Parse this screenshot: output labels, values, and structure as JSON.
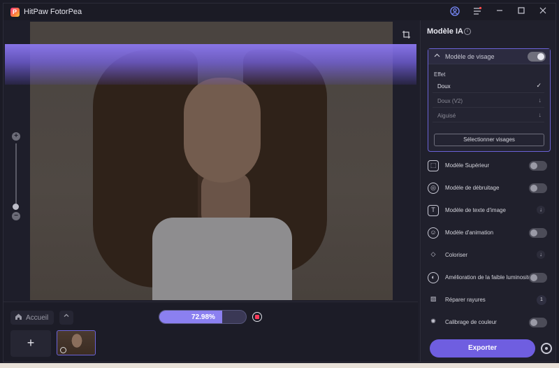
{
  "titlebar": {
    "app_name": "HitPaw FotorPea",
    "logo_letter": "P",
    "icons": [
      "user-icon",
      "menu-icon",
      "minimize-icon",
      "maximize-icon",
      "close-icon"
    ]
  },
  "canvas": {
    "icons": [
      "crop-icon",
      "zoom-in-icon",
      "zoom-out-icon"
    ]
  },
  "bottom": {
    "home_label": "Accueil",
    "progress_text": "72.98%",
    "progress_value": 0.7298,
    "add_symbol": "+"
  },
  "panel": {
    "title": "Modèle IA",
    "face_model": {
      "label": "Modèle de visage",
      "enabled": true,
      "effect_label": "Effet",
      "options": [
        {
          "label": "Doux",
          "state": "selected",
          "icon": "check-icon"
        },
        {
          "label": "Doux (V2)",
          "state": "download",
          "icon": "download-icon"
        },
        {
          "label": "Aiguisé",
          "state": "download",
          "icon": "download-icon"
        }
      ],
      "select_faces_label": "Sélectionner visages"
    },
    "models": [
      {
        "label": "Modèle Supérieur",
        "control": "toggle",
        "enabled": false,
        "icon": "upscale-icon"
      },
      {
        "label": "Modèle de débruitage",
        "control": "toggle",
        "enabled": false,
        "icon": "denoise-icon"
      },
      {
        "label": "Modèle de texte d'image",
        "control": "download",
        "icon": "text-image-icon"
      },
      {
        "label": "Modèle d'animation",
        "control": "toggle",
        "enabled": false,
        "icon": "animation-icon"
      },
      {
        "label": "Coloriser",
        "control": "download",
        "icon": "colorize-icon"
      },
      {
        "label": "Amélioration de la faible luminosité",
        "control": "toggle",
        "enabled": false,
        "icon": "low-light-icon"
      },
      {
        "label": "Réparer rayures",
        "control": "badge",
        "badge": "1",
        "icon": "scratch-repair-icon"
      },
      {
        "label": "Calibrage de couleur",
        "control": "toggle",
        "enabled": false,
        "icon": "color-calibration-icon"
      }
    ],
    "export_label": "Exporter"
  },
  "colors": {
    "accent": "#6f5ee0",
    "progress_fill": "#8b80f0",
    "stop": "#ff3b5a",
    "background": "#1e1e2a"
  }
}
